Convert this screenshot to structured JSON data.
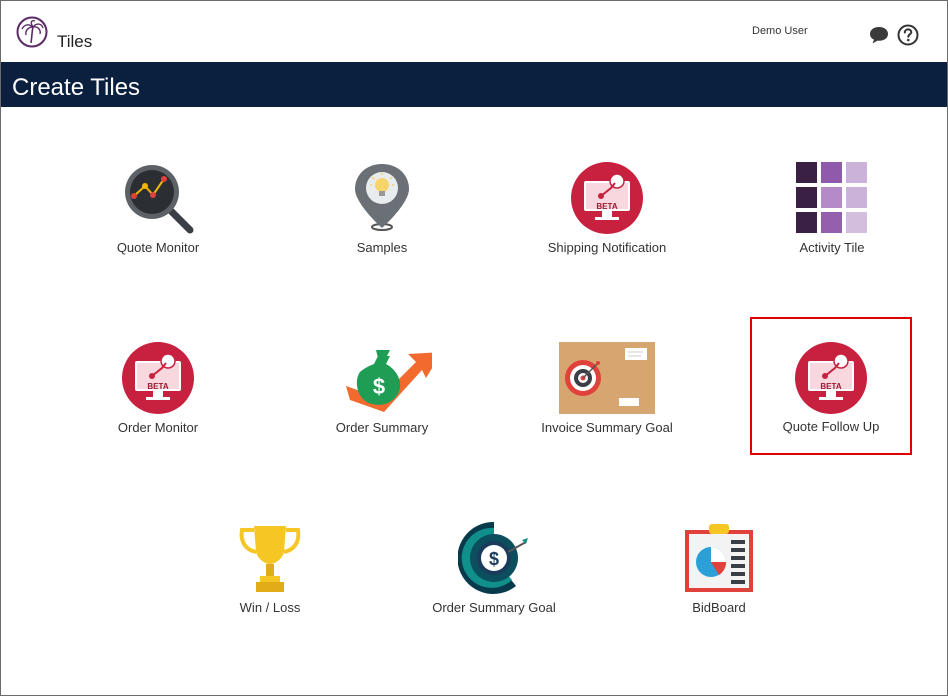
{
  "app": {
    "title": "Tiles",
    "user": "Demo User"
  },
  "header": {
    "title": "Create Tiles"
  },
  "icons": {
    "chat": "chat-bubble-icon",
    "help": "question-circle-icon",
    "logo": "palm-tree-logo"
  },
  "colors": {
    "header_bg": "#0b1f3f",
    "beta_red": "#c8213f",
    "selection_border": "#e00000"
  },
  "tiles": [
    {
      "label": "Quote Monitor",
      "icon": "magnifier-chart-icon"
    },
    {
      "label": "Samples",
      "icon": "location-pin-bulb-icon"
    },
    {
      "label": "Shipping Notification",
      "icon": "beta-monitor-icon"
    },
    {
      "label": "Activity Tile",
      "icon": "purple-grid-icon"
    },
    {
      "label": "Order Monitor",
      "icon": "beta-monitor-icon"
    },
    {
      "label": "Order Summary",
      "icon": "money-bag-arrow-icon"
    },
    {
      "label": "Invoice Summary Goal",
      "icon": "envelope-target-icon"
    },
    {
      "label": "Quote Follow Up",
      "icon": "beta-monitor-icon",
      "selected": true
    },
    {
      "label": "Win / Loss",
      "icon": "trophy-icon"
    },
    {
      "label": "Order Summary Goal",
      "icon": "dollar-target-icon"
    },
    {
      "label": "BidBoard",
      "icon": "clipboard-chart-icon"
    }
  ],
  "beta_badge": "BETA"
}
